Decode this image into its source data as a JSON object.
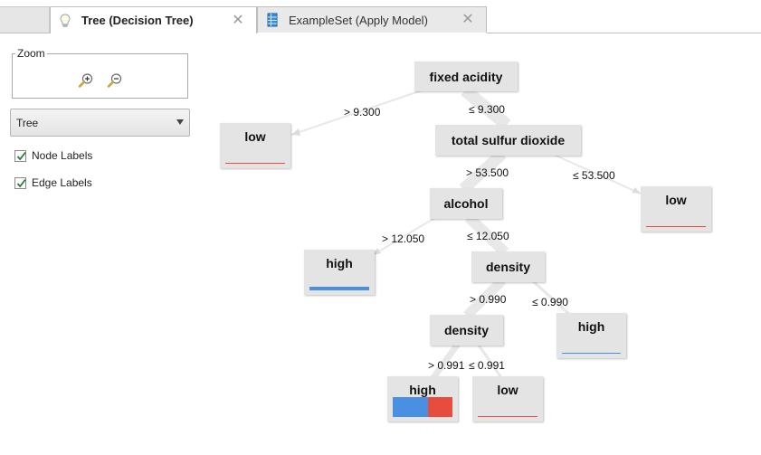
{
  "tabs": [
    {
      "label": "Tree (Decision Tree)",
      "icon": "lightbulb-icon",
      "active": true
    },
    {
      "label": "ExampleSet (Apply Model)",
      "icon": "table-icon",
      "active": false
    }
  ],
  "zoom": {
    "legend": "Zoom",
    "zoom_in_icon": "zoom-in-icon",
    "zoom_out_icon": "zoom-out-icon"
  },
  "view_select": {
    "value": "Tree"
  },
  "options": {
    "node_labels": "Node Labels",
    "edge_labels": "Edge Labels",
    "node_labels_checked": true,
    "edge_labels_checked": true
  },
  "colors": {
    "high": "#4a90e2",
    "low": "#e74c3c"
  },
  "tree": {
    "nodes": {
      "fixed_acidity": "fixed acidity",
      "low1": "low",
      "total_sulfur": "total sulfur dioxide",
      "alcohol": "alcohol",
      "low2": "low",
      "high1": "high",
      "density1": "density",
      "density2": "density",
      "high2": "high",
      "high3": "high",
      "low3": "low"
    },
    "edges": {
      "fa_gt": "> 9.300",
      "fa_le": "≤ 9.300",
      "tsd_gt": "> 53.500",
      "tsd_le": "≤ 53.500",
      "alc_gt": "> 12.050",
      "alc_le": "≤ 12.050",
      "d1_gt": "> 0.990",
      "d1_le": "≤ 0.990",
      "d2_gt": "> 0.991",
      "d2_le": "≤ 0.991"
    }
  }
}
